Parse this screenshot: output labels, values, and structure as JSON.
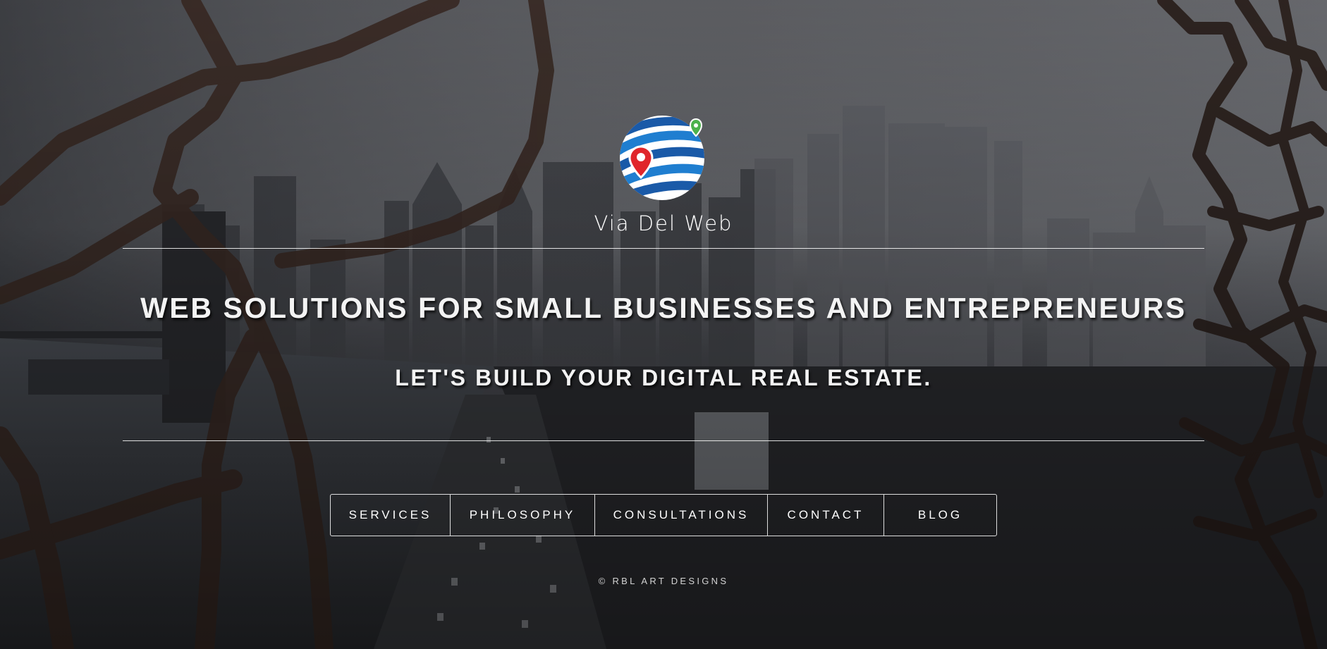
{
  "brand": {
    "name": "Via Del Web",
    "logo_icon": "globe-with-map-pins-icon",
    "colors": {
      "globe_blue": "#1f7ed0",
      "globe_dark_blue": "#1a5aa8",
      "pin_red": "#e0262b",
      "pin_green": "#4cb24c"
    }
  },
  "hero": {
    "headline": "WEB SOLUTIONS FOR SMALL BUSINESSES AND ENTREPRENEURS",
    "subheadline": "LET'S BUILD YOUR DIGITAL REAL ESTATE."
  },
  "nav": {
    "items": [
      {
        "label": "SERVICES"
      },
      {
        "label": "PHILOSOPHY"
      },
      {
        "label": "CONSULTATIONS"
      },
      {
        "label": "CONTACT"
      },
      {
        "label": "BLOG"
      }
    ]
  },
  "footer": {
    "copyright": "© RBL ART DESIGNS"
  }
}
